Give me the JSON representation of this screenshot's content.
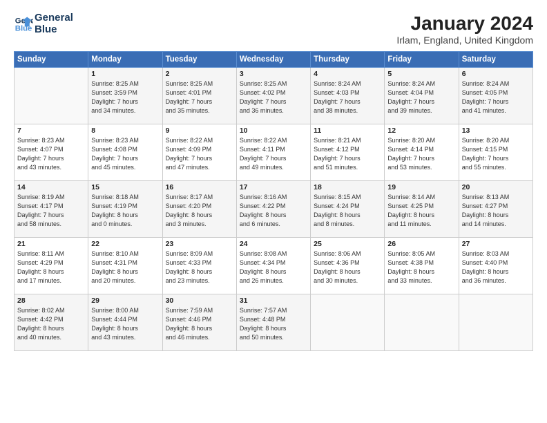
{
  "logo": {
    "line1": "General",
    "line2": "Blue"
  },
  "title": "January 2024",
  "subtitle": "Irlam, England, United Kingdom",
  "weekdays": [
    "Sunday",
    "Monday",
    "Tuesday",
    "Wednesday",
    "Thursday",
    "Friday",
    "Saturday"
  ],
  "weeks": [
    [
      {
        "num": "",
        "info": ""
      },
      {
        "num": "1",
        "info": "Sunrise: 8:25 AM\nSunset: 3:59 PM\nDaylight: 7 hours\nand 34 minutes."
      },
      {
        "num": "2",
        "info": "Sunrise: 8:25 AM\nSunset: 4:01 PM\nDaylight: 7 hours\nand 35 minutes."
      },
      {
        "num": "3",
        "info": "Sunrise: 8:25 AM\nSunset: 4:02 PM\nDaylight: 7 hours\nand 36 minutes."
      },
      {
        "num": "4",
        "info": "Sunrise: 8:24 AM\nSunset: 4:03 PM\nDaylight: 7 hours\nand 38 minutes."
      },
      {
        "num": "5",
        "info": "Sunrise: 8:24 AM\nSunset: 4:04 PM\nDaylight: 7 hours\nand 39 minutes."
      },
      {
        "num": "6",
        "info": "Sunrise: 8:24 AM\nSunset: 4:05 PM\nDaylight: 7 hours\nand 41 minutes."
      }
    ],
    [
      {
        "num": "7",
        "info": "Sunrise: 8:23 AM\nSunset: 4:07 PM\nDaylight: 7 hours\nand 43 minutes."
      },
      {
        "num": "8",
        "info": "Sunrise: 8:23 AM\nSunset: 4:08 PM\nDaylight: 7 hours\nand 45 minutes."
      },
      {
        "num": "9",
        "info": "Sunrise: 8:22 AM\nSunset: 4:09 PM\nDaylight: 7 hours\nand 47 minutes."
      },
      {
        "num": "10",
        "info": "Sunrise: 8:22 AM\nSunset: 4:11 PM\nDaylight: 7 hours\nand 49 minutes."
      },
      {
        "num": "11",
        "info": "Sunrise: 8:21 AM\nSunset: 4:12 PM\nDaylight: 7 hours\nand 51 minutes."
      },
      {
        "num": "12",
        "info": "Sunrise: 8:20 AM\nSunset: 4:14 PM\nDaylight: 7 hours\nand 53 minutes."
      },
      {
        "num": "13",
        "info": "Sunrise: 8:20 AM\nSunset: 4:15 PM\nDaylight: 7 hours\nand 55 minutes."
      }
    ],
    [
      {
        "num": "14",
        "info": "Sunrise: 8:19 AM\nSunset: 4:17 PM\nDaylight: 7 hours\nand 58 minutes."
      },
      {
        "num": "15",
        "info": "Sunrise: 8:18 AM\nSunset: 4:19 PM\nDaylight: 8 hours\nand 0 minutes."
      },
      {
        "num": "16",
        "info": "Sunrise: 8:17 AM\nSunset: 4:20 PM\nDaylight: 8 hours\nand 3 minutes."
      },
      {
        "num": "17",
        "info": "Sunrise: 8:16 AM\nSunset: 4:22 PM\nDaylight: 8 hours\nand 6 minutes."
      },
      {
        "num": "18",
        "info": "Sunrise: 8:15 AM\nSunset: 4:24 PM\nDaylight: 8 hours\nand 8 minutes."
      },
      {
        "num": "19",
        "info": "Sunrise: 8:14 AM\nSunset: 4:25 PM\nDaylight: 8 hours\nand 11 minutes."
      },
      {
        "num": "20",
        "info": "Sunrise: 8:13 AM\nSunset: 4:27 PM\nDaylight: 8 hours\nand 14 minutes."
      }
    ],
    [
      {
        "num": "21",
        "info": "Sunrise: 8:11 AM\nSunset: 4:29 PM\nDaylight: 8 hours\nand 17 minutes."
      },
      {
        "num": "22",
        "info": "Sunrise: 8:10 AM\nSunset: 4:31 PM\nDaylight: 8 hours\nand 20 minutes."
      },
      {
        "num": "23",
        "info": "Sunrise: 8:09 AM\nSunset: 4:33 PM\nDaylight: 8 hours\nand 23 minutes."
      },
      {
        "num": "24",
        "info": "Sunrise: 8:08 AM\nSunset: 4:34 PM\nDaylight: 8 hours\nand 26 minutes."
      },
      {
        "num": "25",
        "info": "Sunrise: 8:06 AM\nSunset: 4:36 PM\nDaylight: 8 hours\nand 30 minutes."
      },
      {
        "num": "26",
        "info": "Sunrise: 8:05 AM\nSunset: 4:38 PM\nDaylight: 8 hours\nand 33 minutes."
      },
      {
        "num": "27",
        "info": "Sunrise: 8:03 AM\nSunset: 4:40 PM\nDaylight: 8 hours\nand 36 minutes."
      }
    ],
    [
      {
        "num": "28",
        "info": "Sunrise: 8:02 AM\nSunset: 4:42 PM\nDaylight: 8 hours\nand 40 minutes."
      },
      {
        "num": "29",
        "info": "Sunrise: 8:00 AM\nSunset: 4:44 PM\nDaylight: 8 hours\nand 43 minutes."
      },
      {
        "num": "30",
        "info": "Sunrise: 7:59 AM\nSunset: 4:46 PM\nDaylight: 8 hours\nand 46 minutes."
      },
      {
        "num": "31",
        "info": "Sunrise: 7:57 AM\nSunset: 4:48 PM\nDaylight: 8 hours\nand 50 minutes."
      },
      {
        "num": "",
        "info": ""
      },
      {
        "num": "",
        "info": ""
      },
      {
        "num": "",
        "info": ""
      }
    ]
  ]
}
